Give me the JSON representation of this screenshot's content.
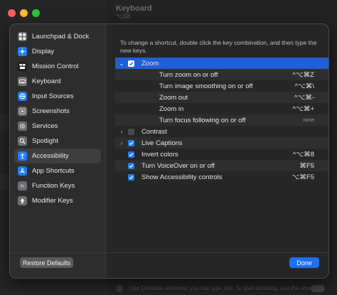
{
  "background": {
    "title": "Keyboard",
    "subtitle": "⌥68",
    "bottom_text": "Use Dictation wherever you can type text. To start dictating, use the shortcut"
  },
  "sidebar": {
    "items": [
      {
        "label": "Launchpad & Dock",
        "icon": "grid-icon",
        "color": "#6e6e73",
        "selected": false
      },
      {
        "label": "Display",
        "icon": "sun-icon",
        "color": "#1f7cf5",
        "selected": false
      },
      {
        "label": "Mission Control",
        "icon": "mission-control-icon",
        "color": "#1c1c1e",
        "selected": false
      },
      {
        "label": "Keyboard",
        "icon": "keyboard-icon",
        "color": "#6e6e73",
        "selected": false
      },
      {
        "label": "Input Sources",
        "icon": "input-sources-icon",
        "color": "#1f7cf5",
        "selected": false
      },
      {
        "label": "Screenshots",
        "icon": "screenshot-icon",
        "color": "#6e6e73",
        "selected": false
      },
      {
        "label": "Services",
        "icon": "gear-icon",
        "color": "#6e6e73",
        "selected": false
      },
      {
        "label": "Spotlight",
        "icon": "magnifier-icon",
        "color": "#6e6e73",
        "selected": false
      },
      {
        "label": "Accessibility",
        "icon": "accessibility-icon",
        "color": "#1f7cf5",
        "selected": true
      },
      {
        "label": "App Shortcuts",
        "icon": "app-store-icon",
        "color": "#1f7cf5",
        "selected": false
      },
      {
        "label": "Function Keys",
        "icon": "fn-icon",
        "color": "#6e6e73",
        "selected": false
      },
      {
        "label": "Modifier Keys",
        "icon": "up-arrow-icon",
        "color": "#6e6e73",
        "selected": false
      }
    ]
  },
  "content": {
    "instructions": "To change a shortcut, double click the key combination, and then type the new keys.",
    "rows": [
      {
        "label": "Zoom",
        "shortcut": "",
        "disclosure": "⌄",
        "checked": true,
        "child": false,
        "highlight": true,
        "none": false
      },
      {
        "label": "Turn zoom on or off",
        "shortcut": "^⌥⌘Z",
        "disclosure": "",
        "checked": null,
        "child": true,
        "highlight": false,
        "none": false
      },
      {
        "label": "Turn image smoothing on or off",
        "shortcut": "^⌥⌘\\",
        "disclosure": "",
        "checked": null,
        "child": true,
        "highlight": false,
        "none": false
      },
      {
        "label": "Zoom out",
        "shortcut": "^⌥⌘-",
        "disclosure": "",
        "checked": null,
        "child": true,
        "highlight": false,
        "none": false
      },
      {
        "label": "Zoom in",
        "shortcut": "^⌥⌘+",
        "disclosure": "",
        "checked": null,
        "child": true,
        "highlight": false,
        "none": false
      },
      {
        "label": "Turn focus following on or off",
        "shortcut": "none",
        "disclosure": "",
        "checked": null,
        "child": true,
        "highlight": false,
        "none": true
      },
      {
        "label": "Contrast",
        "shortcut": "",
        "disclosure": "›",
        "checked": false,
        "child": false,
        "highlight": false,
        "none": false
      },
      {
        "label": "Live Captions",
        "shortcut": "",
        "disclosure": "›",
        "checked": true,
        "child": false,
        "highlight": false,
        "none": false
      },
      {
        "label": "Invert colors",
        "shortcut": "^⌥⌘8",
        "disclosure": "",
        "checked": true,
        "child": false,
        "highlight": false,
        "none": false
      },
      {
        "label": "Turn VoiceOver on or off",
        "shortcut": "⌘F5",
        "disclosure": "",
        "checked": true,
        "child": false,
        "highlight": false,
        "none": false
      },
      {
        "label": "Show Accessibility controls",
        "shortcut": "⌥⌘F5",
        "disclosure": "",
        "checked": true,
        "child": false,
        "highlight": false,
        "none": false
      }
    ]
  },
  "footer": {
    "restore_label": "Restore Defaults",
    "done_label": "Done"
  },
  "colors": {
    "accent": "#1f6ff0",
    "highlight": "#1f5fd8"
  }
}
